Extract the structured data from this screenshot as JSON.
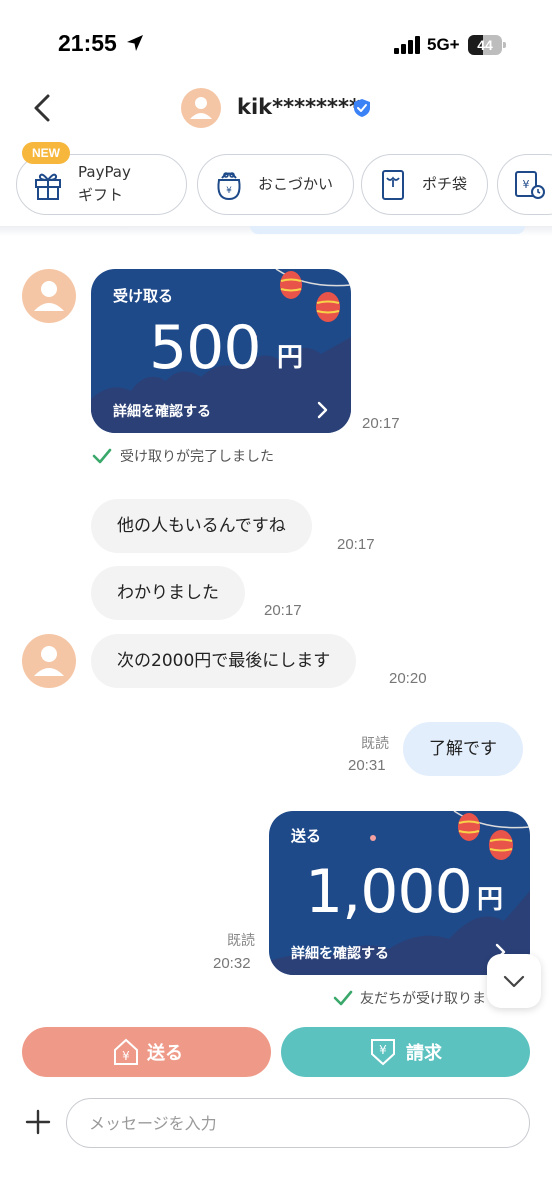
{
  "status_bar": {
    "time": "21:55",
    "network": "5G+",
    "battery": "44",
    "battery_level_percent": 44
  },
  "header": {
    "name": "kik********"
  },
  "quick_actions": {
    "new_badge": "NEW",
    "items": [
      {
        "label_line1": "PayPay",
        "label_line2": "ギフト"
      },
      {
        "label": "おこづかい"
      },
      {
        "label": "ポチ袋"
      }
    ]
  },
  "messages": {
    "received_card": {
      "label": "受け取る",
      "amount": "500",
      "currency": "円",
      "link": "詳細を確認する",
      "time": "20:17",
      "status": "受け取りが完了しました"
    },
    "msg1": {
      "text": "他の人もいるんですね",
      "time": "20:17"
    },
    "msg2": {
      "text": "わかりました",
      "time": "20:17"
    },
    "msg3": {
      "text": "次の2000円で最後にします",
      "time": "20:20"
    },
    "mine1": {
      "text": "了解です",
      "time": "20:31",
      "read": "既読"
    },
    "sent_card": {
      "label": "送る",
      "amount": "1,000",
      "currency": "円",
      "link": "詳細を確認する",
      "time": "20:32",
      "read": "既読",
      "status": "友だちが受け取りま"
    }
  },
  "actions": {
    "send_label": "送る",
    "request_label": "請求"
  },
  "input": {
    "placeholder": "メッセージを入力"
  },
  "colors": {
    "card_bg": "#1f4a8a",
    "send_button": "#ef9a88",
    "request_button": "#5cc2c0",
    "my_bubble": "#e3eefc",
    "check": "#3aa86b"
  }
}
